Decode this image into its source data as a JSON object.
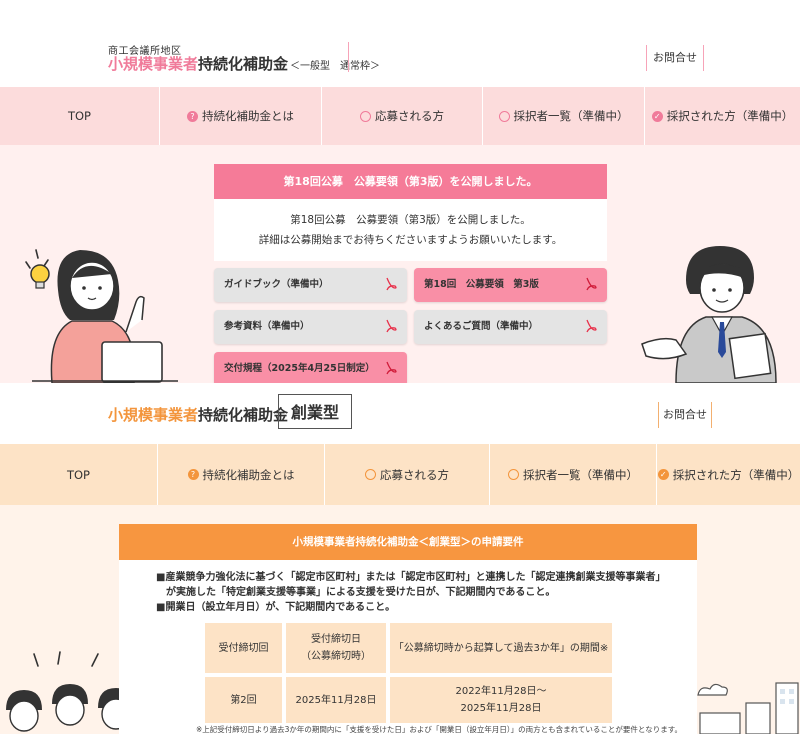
{
  "section1": {
    "header": {
      "org_small": "商工会議所地区",
      "title_accent": "小規模事業者",
      "title_main": "持続化補助金",
      "title_sub": "＜一般型　通常枠＞",
      "contact": "お問合せ"
    },
    "nav": [
      {
        "label": "TOP",
        "icon": ""
      },
      {
        "label": "持続化補助金とは",
        "icon": "question-icon"
      },
      {
        "label": "応募される方",
        "icon": "person-icon"
      },
      {
        "label": "採択者一覧（準備中）",
        "icon": "person-icon"
      },
      {
        "label": "採択された方（準備中）",
        "icon": "person-check-icon"
      }
    ],
    "notice": {
      "heading": "第18回公募　公募要領（第3版）を公開しました。",
      "line1": "第18回公募　公募要領（第3版）を公開しました。",
      "line2": "詳細は公募開始までお待ちくださいますようお願いいたします。"
    },
    "buttons": [
      {
        "label": "ガイドブック（準備中）",
        "style": "gray"
      },
      {
        "label": "第18回　公募要領　第3版",
        "style": "pink"
      },
      {
        "label": "参考資料（準備中）",
        "style": "gray"
      },
      {
        "label": "よくあるご質問（準備中）",
        "style": "gray"
      },
      {
        "label": "交付規程（2025年4月25日制定）",
        "style": "pink"
      }
    ],
    "colors": {
      "accent": "#f07b9a",
      "nav_bg": "#fcdcdc",
      "body_bg": "#fff0ef"
    }
  },
  "section2": {
    "header": {
      "title_accent": "小規模事業者",
      "title_main": "持続化補助金",
      "badge": "創業型",
      "contact": "お問合せ"
    },
    "nav": [
      {
        "label": "TOP",
        "icon": ""
      },
      {
        "label": "持続化補助金とは",
        "icon": "question-icon"
      },
      {
        "label": "応募される方",
        "icon": "person-icon"
      },
      {
        "label": "採択者一覧（準備中）",
        "icon": "person-icon"
      },
      {
        "label": "採択された方（準備中）",
        "icon": "person-check-icon"
      }
    ],
    "requirements": {
      "heading": "小規模事業者持続化補助金＜創業型＞の申請要件",
      "line1": "■産業競争力強化法に基づく「認定市区町村」または「認定市区町村」と連携した「認定連携創業支援等事業者」",
      "line2": "　が実施した「特定創業支援等事業」による支援を受けた日が、下記期間内であること。",
      "line3": "■開業日（設立年月日）が、下記期間内であること。",
      "table": {
        "headers": [
          "受付締切回",
          "受付締切日",
          "（公募締切時）",
          "「公募締切時から起算して過去3か年」の期間※"
        ],
        "row": [
          "第2回",
          "2025年11月28日",
          "2022年11月28日～",
          "2025年11月28日"
        ]
      },
      "footnote": "※上記受付締切日より過去3か年の期間内に「支援を受けた日」および「開業日（設立年月日）」の両方とも含まれていることが要件となります。"
    },
    "colors": {
      "accent": "#f3953c",
      "nav_bg": "#fde3c6",
      "body_bg": "#fff3ea"
    }
  }
}
